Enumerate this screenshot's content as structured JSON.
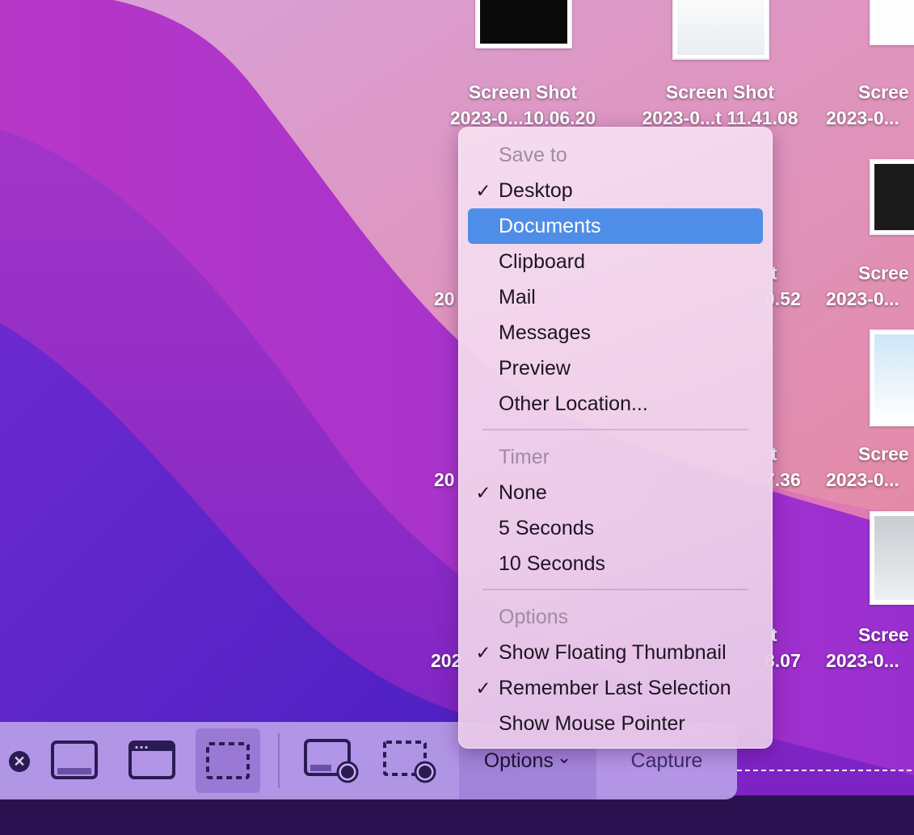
{
  "desktop": {
    "icons": [
      {
        "line1": "Screen Shot",
        "line2": "2023-0...10.06.20"
      },
      {
        "line1": "Screen Shot",
        "line2": "2023-0...t 11.41.08"
      },
      {
        "line1": "Scree",
        "line2": "2023-0..."
      },
      {
        "line1": "t",
        "line2": "0.52"
      },
      {
        "line1": "Scree",
        "line2": "2023-0..."
      },
      {
        "line1": "t",
        "line2": "7.36"
      },
      {
        "line1": "Scree",
        "line2": "2023-0..."
      },
      {
        "line1": "t",
        "line2": "8.07"
      },
      {
        "line1": "Scree",
        "line2": "2023-0..."
      }
    ],
    "partial_left": [
      "20",
      "20",
      "202"
    ]
  },
  "menu": {
    "save_to_header": "Save to",
    "save_to_items": [
      {
        "label": "Desktop",
        "checked": true
      },
      {
        "label": "Documents",
        "highlighted": true
      },
      {
        "label": "Clipboard"
      },
      {
        "label": "Mail"
      },
      {
        "label": "Messages"
      },
      {
        "label": "Preview"
      },
      {
        "label": "Other Location..."
      }
    ],
    "timer_header": "Timer",
    "timer_items": [
      {
        "label": "None",
        "checked": true
      },
      {
        "label": "5 Seconds"
      },
      {
        "label": "10 Seconds"
      }
    ],
    "options_header": "Options",
    "options_items": [
      {
        "label": "Show Floating Thumbnail",
        "checked": true
      },
      {
        "label": "Remember Last Selection",
        "checked": true
      },
      {
        "label": "Show Mouse Pointer"
      }
    ],
    "check_glyph": "✓"
  },
  "toolbar": {
    "close_glyph": "✕",
    "options_label": "Options",
    "options_chevron": "⌄",
    "capture_label": "Capture",
    "tools": [
      {
        "name": "capture-entire-screen",
        "icon": "screen-icon"
      },
      {
        "name": "capture-selected-window",
        "icon": "window-icon"
      },
      {
        "name": "capture-selected-portion",
        "icon": "selection-icon",
        "selected": true
      },
      {
        "name": "record-entire-screen",
        "icon": "record-screen-icon"
      },
      {
        "name": "record-selected-portion",
        "icon": "record-selection-icon"
      }
    ]
  },
  "colors": {
    "highlight": "#4f8ee8",
    "toolbar_icon": "#2b1b55"
  }
}
